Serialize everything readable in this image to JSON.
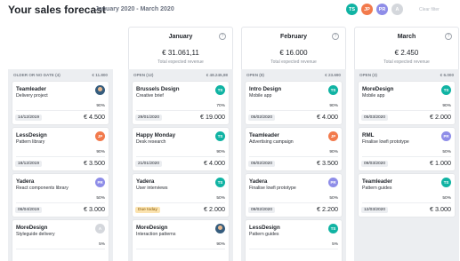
{
  "header": {
    "title": "Your sales forecast",
    "date_range": "January 2020 - March 2020",
    "clear_filter": "Clear filter",
    "avatars": [
      {
        "initials": "TS",
        "color": "#10b3a3"
      },
      {
        "initials": "JP",
        "color": "#f27a4c"
      },
      {
        "initials": "PR",
        "color": "#8e8de8"
      },
      {
        "initials": "A",
        "color": "#d4d7dc"
      }
    ]
  },
  "months": [
    {
      "name": "January",
      "amount": "€ 31.061,11",
      "label": "Total expected revenue"
    },
    {
      "name": "February",
      "amount": "€ 16.000",
      "label": "Total expected revenue"
    },
    {
      "name": "March",
      "amount": "€ 2.450",
      "label": "Total expected revenue"
    }
  ],
  "columns": [
    {
      "title": "OLDER OR NO DATE (4)",
      "total": "€ 11.800",
      "cards": [
        {
          "name": "Teamleader",
          "desc": "Delivery project",
          "pct": "90%",
          "date": "14/12/2019",
          "amount": "€ 4.500",
          "avatar": "photo"
        },
        {
          "name": "LessDesign",
          "desc": "Pattern library",
          "pct": "90%",
          "date": "18/12/2019",
          "amount": "€ 3.500",
          "avatar": "JP"
        },
        {
          "name": "Yadera",
          "desc": "React components library",
          "pct": "50%",
          "date": "06/04/2019",
          "amount": "€ 3.000",
          "avatar": "PR"
        },
        {
          "name": "MoreDesign",
          "desc": "Styleguide delivery",
          "pct": "5%",
          "date": "",
          "amount": "",
          "avatar": "A"
        }
      ]
    },
    {
      "title": "OPEN (12)",
      "total": "€ 48.245,98",
      "cards": [
        {
          "name": "Brussels Design",
          "desc": "Creative brief",
          "pct": "70%",
          "date": "29/01/2020",
          "amount": "€ 19.000",
          "avatar": "TS"
        },
        {
          "name": "Happy Monday",
          "desc": "Desk research",
          "pct": "90%",
          "date": "21/01/2020",
          "amount": "€ 4.000",
          "avatar": "TS"
        },
        {
          "name": "Yadera",
          "desc": "User interviews",
          "pct": "50%",
          "date": "Due today",
          "amount": "€ 2.000",
          "avatar": "TS",
          "due": true
        },
        {
          "name": "MoreDesign",
          "desc": "Interaction patterns",
          "pct": "90%",
          "date": "",
          "amount": "",
          "avatar": "photo"
        }
      ]
    },
    {
      "title": "OPEN (8)",
      "total": "€ 23.690",
      "cards": [
        {
          "name": "Intro Design",
          "desc": "Mobile app",
          "pct": "90%",
          "date": "05/02/2020",
          "amount": "€ 4.000",
          "avatar": "TS"
        },
        {
          "name": "Teamleader",
          "desc": "Advertising campaign",
          "pct": "90%",
          "date": "05/02/2020",
          "amount": "€ 3.500",
          "avatar": "JP"
        },
        {
          "name": "Yadera",
          "desc": "Finalise lowfi prototype",
          "pct": "50%",
          "date": "09/02/2020",
          "amount": "€ 2.200",
          "avatar": "PR"
        },
        {
          "name": "LessDesign",
          "desc": "Pattern guides",
          "pct": "5%",
          "date": "",
          "amount": "",
          "avatar": "TS"
        }
      ]
    },
    {
      "title": "OPEN (3)",
      "total": "€ 6.000",
      "cards": [
        {
          "name": "MoreDesign",
          "desc": "Mobile app",
          "pct": "90%",
          "date": "05/03/2020",
          "amount": "€ 2.000",
          "avatar": "TS"
        },
        {
          "name": "RML",
          "desc": "Finalise lowfi prototype",
          "pct": "50%",
          "date": "09/03/2020",
          "amount": "€ 1.000",
          "avatar": "PR"
        },
        {
          "name": "Teamleader",
          "desc": "Pattern guides",
          "pct": "50%",
          "date": "12/03/2020",
          "amount": "€ 3.000",
          "avatar": "TS"
        }
      ]
    }
  ]
}
